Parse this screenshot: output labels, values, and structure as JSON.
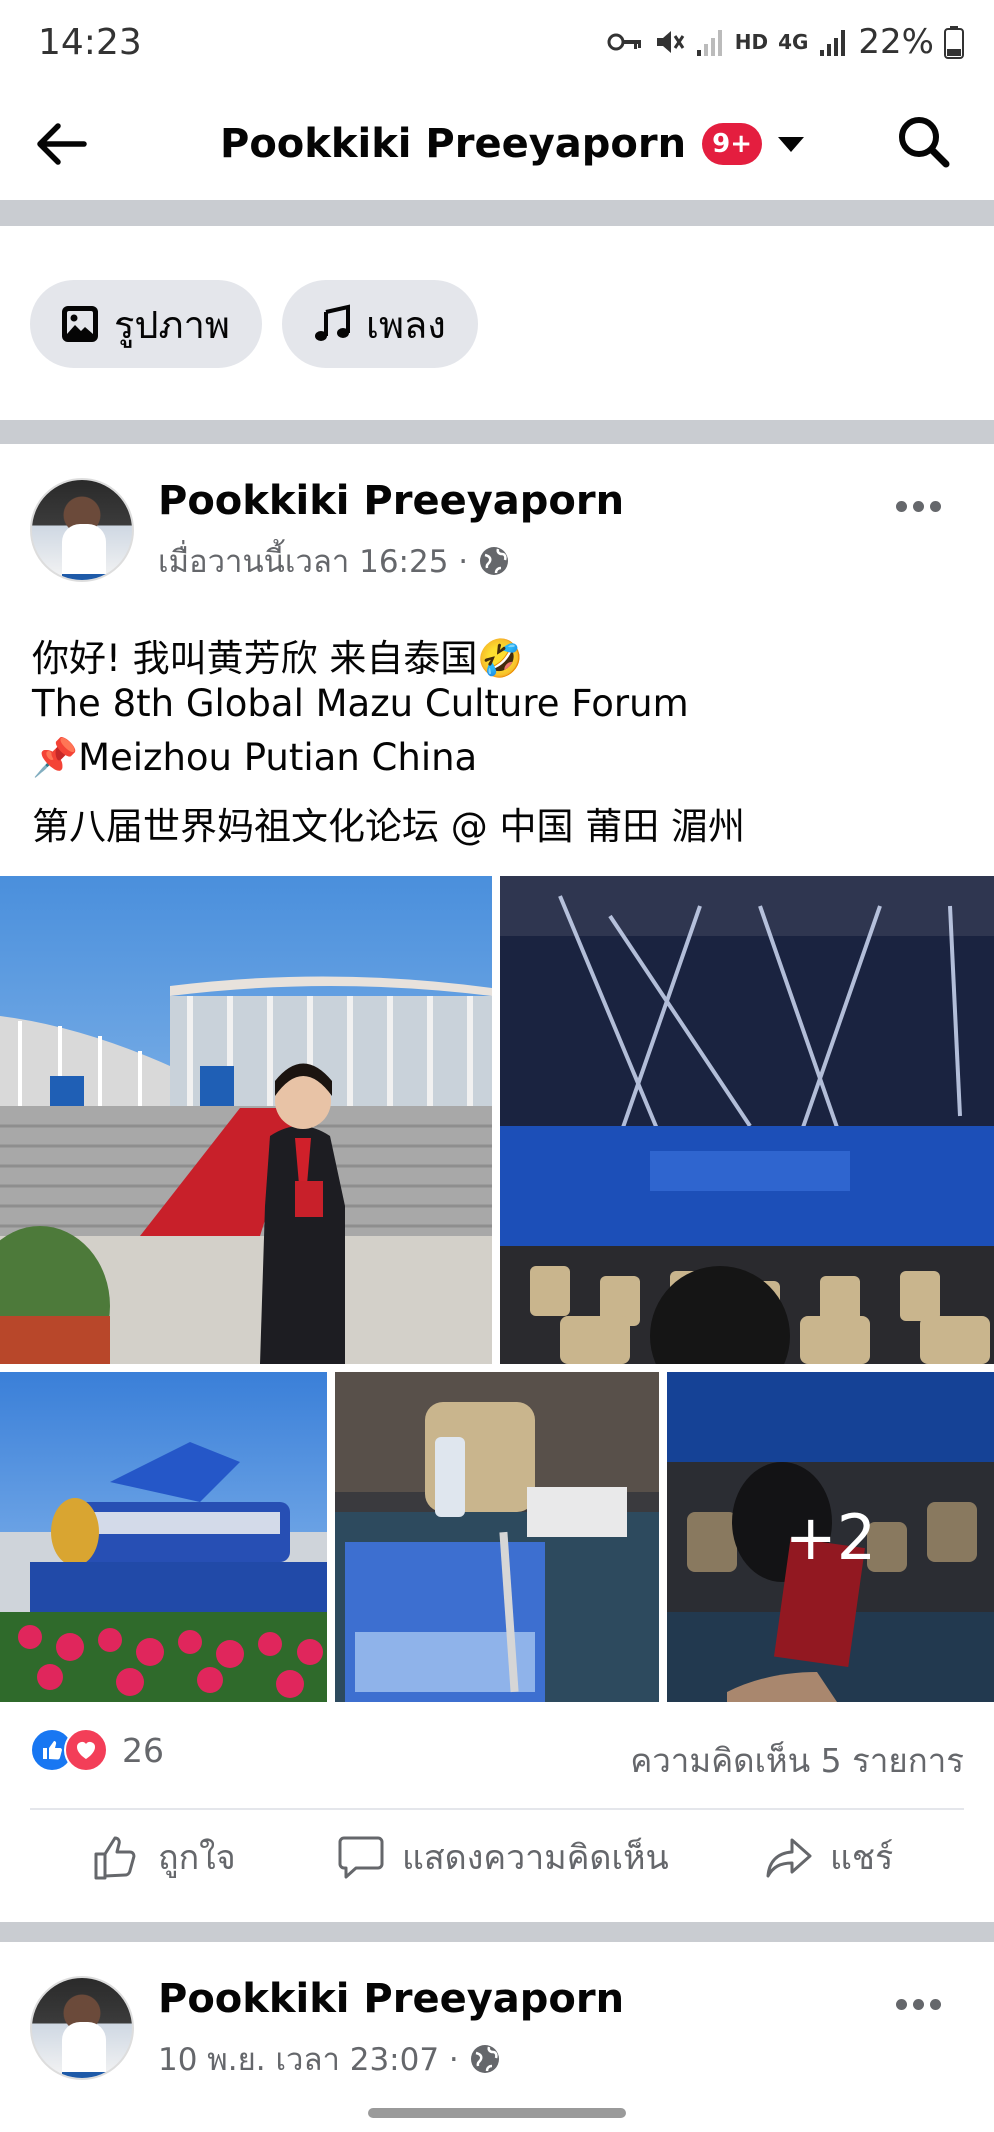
{
  "status_bar": {
    "time": "14:23",
    "network": "HD",
    "network_type": "4G",
    "battery": "22%"
  },
  "app_bar": {
    "title": "Pookkiki Preeyaporn",
    "notification_badge": "9+"
  },
  "filters": [
    {
      "label": "รูปภาพ",
      "icon": "photo-icon"
    },
    {
      "label": "เพลง",
      "icon": "music-note-icon"
    }
  ],
  "post": {
    "author": "Pookkiki Preeyaporn",
    "timestamp": "เมื่อวานนี้เวลา 16:25 ·",
    "privacy_icon": "globe-icon",
    "text_lines": [
      "你好! 我叫黄芳欣 来自泰国🤣",
      "The 8th Global Mazu Culture Forum",
      "📌Meizhou Putian China",
      "第八届世界妈祖文化论坛 @ 中国 莆田 湄州"
    ],
    "more_photos": "+2",
    "reaction_count": "26",
    "comments": "ความคิดเห็น 5 รายการ",
    "actions": {
      "like": "ถูกใจ",
      "comment": "แสดงความคิดเห็น",
      "share": "แชร์"
    }
  },
  "next_post": {
    "author": "Pookkiki Preeyaporn",
    "timestamp": "10 พ.ย. เวลา 23:07 ·"
  },
  "colors": {
    "like_blue": "#1877f2",
    "love_red": "#f33e58",
    "badge_red": "#e41e3f",
    "separator": "#c9ccd1",
    "secondary_text": "#65676b"
  }
}
